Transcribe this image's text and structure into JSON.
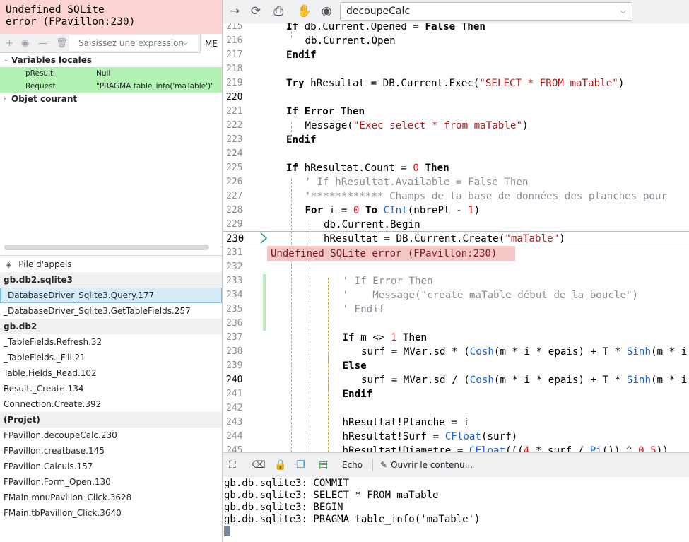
{
  "error_banner": {
    "line1": "Undefined SQLite",
    "line2": "error (FPavillon:230)"
  },
  "expression_bar": {
    "placeholder": "Saisissez une expression",
    "me_label": "ME",
    "icons": [
      "plus-icon",
      "eye-icon",
      "minus-icon",
      "trash-icon"
    ]
  },
  "variables": {
    "locals_label": "Variables locales",
    "items": [
      {
        "name": "pResult",
        "value": "Null"
      },
      {
        "name": "Request",
        "value": "\"PRAGMA table_info('maTable')\""
      }
    ],
    "current_object_label": "Objet courant"
  },
  "call_stack": {
    "title": "Pile d'appels",
    "groups": [
      {
        "name": "gb.db2.sqlite3",
        "items": [
          "_DatabaseDriver_Sqlite3.Query.177",
          "_DatabaseDriver_Sqlite3.GetTableFields.257"
        ]
      },
      {
        "name": "gb.db2",
        "items": [
          "_TableFields.Refresh.32",
          "_TableFields._Fill.21",
          "Table.Fields_Read.102",
          "Result._Create.134",
          "Connection.Create.392"
        ]
      },
      {
        "name": "(Projet)",
        "items": [
          "FPavillon.decoupeCalc.230",
          "FPavillon.creatbase.145",
          "FPavillon.Calculs.157",
          "FPavillon.Form_Open.130",
          "FMain.mnuPavillon_Click.3628",
          "FMain.tbPavillon_Click.3640"
        ]
      }
    ],
    "selected": "_DatabaseDriver_Sqlite3.Query.177"
  },
  "toolbar": {
    "function_select": "decoupeCalc",
    "icons": [
      "forward-arrow-icon",
      "refresh-icon",
      "print-icon",
      "stop-hand-icon",
      "eye-icon"
    ]
  },
  "editor": {
    "current_line": "230",
    "inline_error": "Undefined SQLite error (FPavillon:230)",
    "line_numbers": [
      "215",
      "216",
      "217",
      "218",
      "219",
      "220",
      "221",
      "222",
      "223",
      "224",
      "225",
      "226",
      "227",
      "228",
      "229",
      "230",
      "231",
      "232",
      "233",
      "234",
      "235",
      "236",
      "237",
      "238",
      "239",
      "240",
      "241",
      "242",
      "243",
      "244",
      "245"
    ],
    "lines": [
      {
        "no": 215,
        "t": "If db.Current.Opened = False Then"
      },
      {
        "no": 216,
        "t": "db.Current.Open"
      },
      {
        "no": 217,
        "t": "Endif"
      },
      {
        "no": 218,
        "t": ""
      },
      {
        "no": 219,
        "t": "Try hResultat = DB.Current.Exec(\"SELECT * FROM maTable\")"
      },
      {
        "no": 220,
        "t": ""
      },
      {
        "no": 221,
        "t": "If Error Then"
      },
      {
        "no": 222,
        "t": "Message(\"Exec select * from maTable\")"
      },
      {
        "no": 223,
        "t": "Endif"
      },
      {
        "no": 224,
        "t": ""
      },
      {
        "no": 225,
        "t": "If hResultat.Count = 0 Then"
      },
      {
        "no": 226,
        "t": "' If hResultat.Available = False Then"
      },
      {
        "no": 227,
        "t": "'************ Champs de la base de données des planches pour"
      },
      {
        "no": 228,
        "t": "For i = 0 To CInt(nbrePl - 1)"
      },
      {
        "no": 229,
        "t": "db.Current.Begin"
      },
      {
        "no": 230,
        "t": "hResultat = DB.Current.Create(\"maTable\")"
      },
      {
        "no": 233,
        "t": "' If Error Then"
      },
      {
        "no": 234,
        "t": "'    Message(\"create maTable début de la boucle\")"
      },
      {
        "no": 235,
        "t": "' Endif"
      },
      {
        "no": 237,
        "t": "If m <> 1 Then"
      },
      {
        "no": 238,
        "t": "surf = MVar.sd * (Cosh(m * i * epais) + T * Sinh(m * i"
      },
      {
        "no": 239,
        "t": "Else"
      },
      {
        "no": 240,
        "t": "surf = MVar.sd / (Cosh(m * i * epais) + T * Sinh(m * i"
      },
      {
        "no": 241,
        "t": "Endif"
      },
      {
        "no": 243,
        "t": "hResultat!Planche = i"
      },
      {
        "no": 244,
        "t": "hResultat!Surf = CFloat(surf)"
      },
      {
        "no": 245,
        "t": "hResultat!Diametre = CFloat(((4 * surf / Pi()) ^ 0.5))"
      }
    ]
  },
  "output": {
    "echo_label": "Echo",
    "open_label": "Ouvrir le contenu...",
    "icons": [
      "fit-icon",
      "clear-icon",
      "lock-icon",
      "copy-icon",
      "save-icon",
      "pencil-icon"
    ],
    "lines": [
      "gb.db.sqlite3: COMMIT",
      "gb.db.sqlite3: SELECT * FROM maTable",
      "gb.db.sqlite3: BEGIN",
      "gb.db.sqlite3: PRAGMA table_info('maTable')"
    ]
  },
  "colors": {
    "error_bg": "#fdd3d3",
    "var_bg": "#b4f2b4",
    "keyword": "#000000",
    "string": "#b41818",
    "function": "#1c62d4",
    "comment": "#8a8f99",
    "number": "#e0161b"
  }
}
